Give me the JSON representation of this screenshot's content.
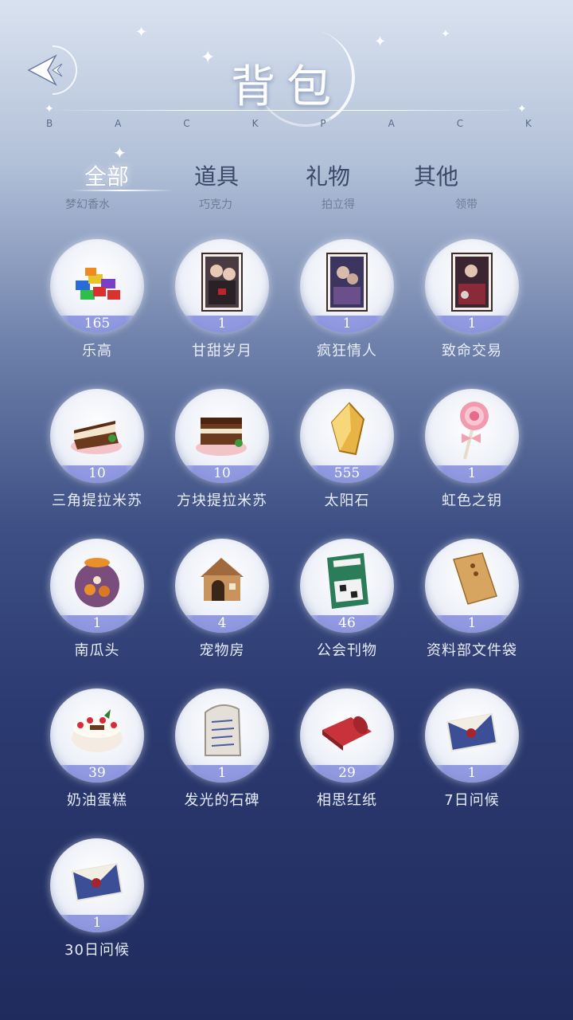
{
  "header": {
    "title": "背包",
    "subtitle_letters": [
      "B",
      "A",
      "C",
      "K",
      "P",
      "A",
      "C",
      "K"
    ],
    "back_icon": "back-arrow-icon"
  },
  "tabs": [
    {
      "label": "全部",
      "active": true
    },
    {
      "label": "道具",
      "active": false
    },
    {
      "label": "礼物",
      "active": false
    },
    {
      "label": "其他",
      "active": false
    }
  ],
  "ghost_row": [
    "梦幻香水",
    "巧克力",
    "拍立得",
    "领带"
  ],
  "items": [
    {
      "name": "乐高",
      "count": "165",
      "icon": "lego-bricks-icon"
    },
    {
      "name": "甘甜岁月",
      "count": "1",
      "icon": "photo-card-icon"
    },
    {
      "name": "疯狂情人",
      "count": "1",
      "icon": "photo-card-icon"
    },
    {
      "name": "致命交易",
      "count": "1",
      "icon": "photo-card-icon"
    },
    {
      "name": "三角提拉米苏",
      "count": "10",
      "icon": "tiramisu-slice-icon"
    },
    {
      "name": "方块提拉米苏",
      "count": "10",
      "icon": "tiramisu-block-icon"
    },
    {
      "name": "太阳石",
      "count": "555",
      "icon": "sun-stone-icon"
    },
    {
      "name": "虹色之钥",
      "count": "1",
      "icon": "lollipop-key-icon"
    },
    {
      "name": "南瓜头",
      "count": "1",
      "icon": "pumpkin-jar-icon"
    },
    {
      "name": "宠物房",
      "count": "4",
      "icon": "doghouse-icon"
    },
    {
      "name": "公会刊物",
      "count": "46",
      "icon": "magazine-icon"
    },
    {
      "name": "资料部文件袋",
      "count": "1",
      "icon": "envelope-folder-icon"
    },
    {
      "name": "奶油蛋糕",
      "count": "39",
      "icon": "cream-cake-icon"
    },
    {
      "name": "发光的石碑",
      "count": "1",
      "icon": "stone-tablet-icon"
    },
    {
      "name": "相思红纸",
      "count": "29",
      "icon": "red-paper-scroll-icon"
    },
    {
      "name": "7日问候",
      "count": "1",
      "icon": "greeting-letter-icon"
    },
    {
      "name": "30日问候",
      "count": "1",
      "icon": "greeting-letter-icon"
    }
  ],
  "colors": {
    "accent": "#8c96dc",
    "tab_inactive": "#3b4868",
    "bg_top": "#d9e2ef",
    "bg_bottom": "#1f2b5d"
  }
}
